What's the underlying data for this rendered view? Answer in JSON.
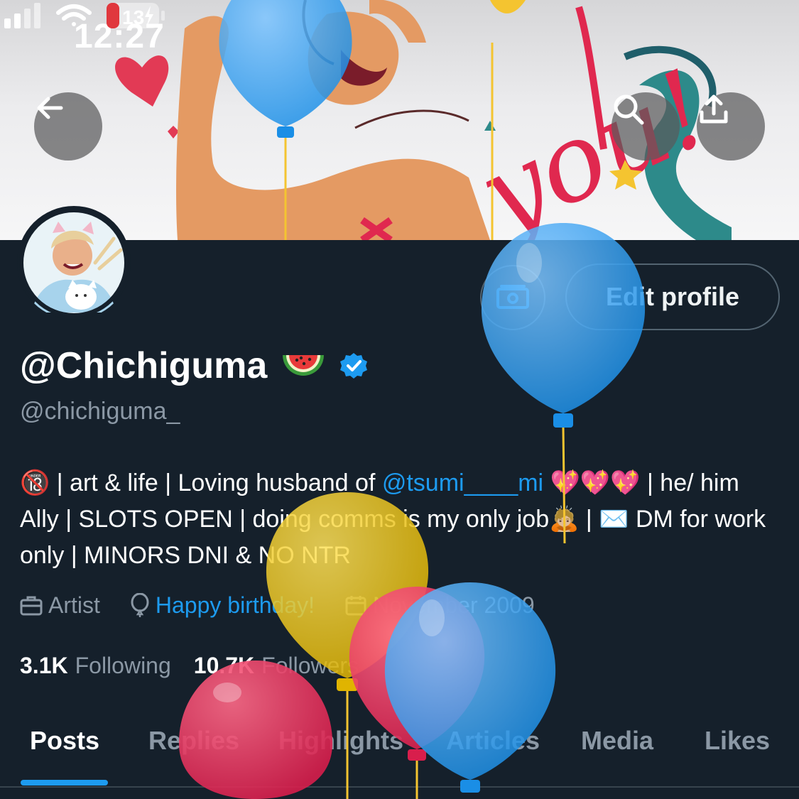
{
  "status_bar": {
    "time": "12:27",
    "battery": "13",
    "icons": [
      "signal-icon",
      "wifi-icon",
      "battery-charging-icon"
    ],
    "battery_color": "#e0383e"
  },
  "header": {
    "back_icon": "arrow-left-icon",
    "search_icon": "search-icon",
    "share_icon": "share-icon"
  },
  "profile": {
    "display_name": "@Chichiguma",
    "name_emoji": "watermelon",
    "verified_badge": "verified-check-icon",
    "handle": "@chichiguma_",
    "edit_button": "Edit profile",
    "tip_icon": "money-icon"
  },
  "bio": {
    "segments": [
      {
        "text": "🔞",
        "type": "text"
      },
      {
        "text": " | art & life | Loving husband of ",
        "type": "text"
      },
      {
        "text": "@tsumi____mi",
        "type": "mention"
      },
      {
        "text": " 💖💖💖 | he/ him Ally | SLOTS OPEN | doing comms is my only job🙇🏼 | ✉️ DM for work only | MINORS DNI & NO NTR",
        "type": "text"
      }
    ]
  },
  "meta": {
    "profession": "Artist",
    "birthday_link": "Happy birthday!",
    "joined": "November 2009",
    "icons": [
      "briefcase-icon",
      "balloon-icon",
      "calendar-icon"
    ]
  },
  "stats": {
    "following_count": "3.1K",
    "following_label": "Following",
    "followers_count": "10.7K",
    "followers_label": "Followers"
  },
  "tabs": {
    "items": [
      "Posts",
      "Replies",
      "Highlights",
      "Articles",
      "Media",
      "Likes"
    ],
    "active": "Posts"
  },
  "colors": {
    "background": "#15202b",
    "accent": "#1d9bf0",
    "muted": "#8b98a5",
    "border": "#536471"
  }
}
